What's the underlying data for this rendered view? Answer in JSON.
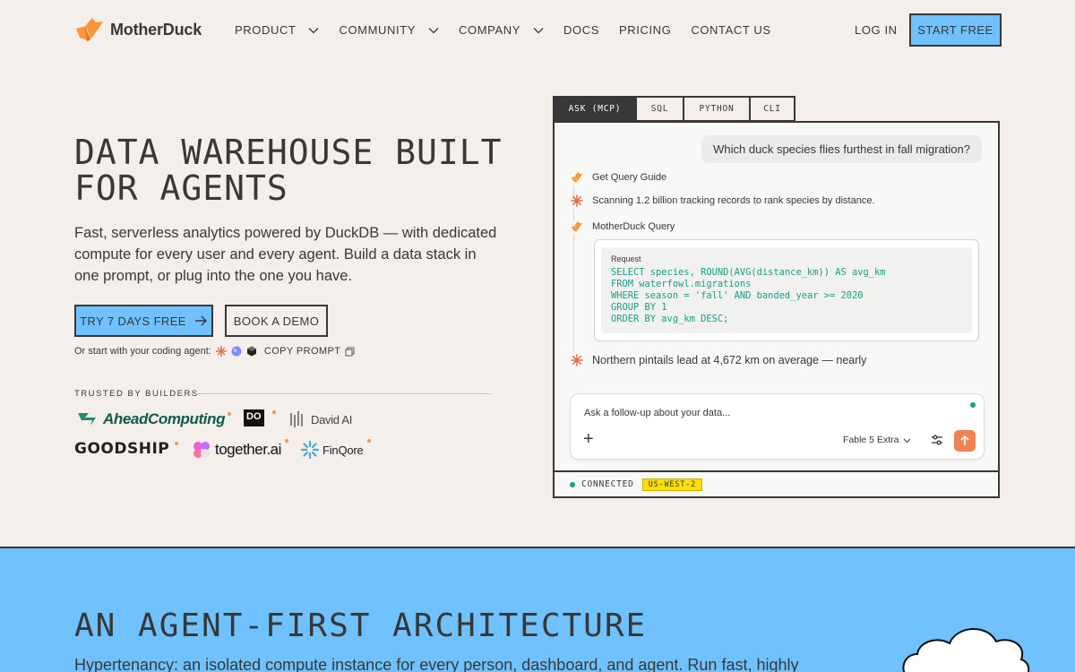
{
  "nav": {
    "brand": "MotherDuck",
    "links": [
      {
        "label": "PRODUCT",
        "dropdown": true
      },
      {
        "label": "COMMUNITY",
        "dropdown": true
      },
      {
        "label": "COMPANY",
        "dropdown": true
      },
      {
        "label": "DOCS",
        "dropdown": false
      },
      {
        "label": "PRICING",
        "dropdown": false
      },
      {
        "label": "CONTACT US",
        "dropdown": false
      }
    ],
    "login": "LOG IN",
    "start_free": "START FREE"
  },
  "hero": {
    "title_line1": "DATA WAREHOUSE BUILT",
    "title_line2": "FOR AGENTS",
    "subtitle": "Fast, serverless analytics powered by DuckDB — with dedicated compute for every user and every agent. Build a data stack in one prompt, or plug into the one you have.",
    "try_button": "TRY 7 DAYS FREE",
    "demo_button": "BOOK A DEMO",
    "coding_agent_text": "Or start with your coding agent:",
    "copy_prompt": "COPY PROMPT",
    "trusted_label": "TRUSTED BY BUILDERS",
    "logos": [
      "AheadComputing",
      "DO",
      "David AI",
      "GOODSHIP",
      "together.ai",
      "FinQore"
    ]
  },
  "terminal": {
    "tabs": [
      "ASK (MCP)",
      "SQL",
      "PYTHON",
      "CLI"
    ],
    "active_tab": "ASK (MCP)",
    "user_message": "Which duck species flies furthest in fall migration?",
    "step_guide": "Get Query Guide",
    "step_scan": "Scanning 1.2 billion tracking records to rank species by distance.",
    "step_query": "MotherDuck Query",
    "request_label": "Request",
    "sql": "SELECT species, ROUND(AVG(distance_km)) AS avg_km\nFROM waterfowl.migrations\nWHERE season = 'fall' AND banded_year >= 2020\nGROUP BY 1\nORDER BY avg_km DESC;",
    "answer": "Northern pintails lead at 4,672 km on average — nearly",
    "input_placeholder": "Ask a follow-up about your data...",
    "model": "Fable 5 Extra",
    "status": "CONNECTED",
    "region": "US-WEST-2"
  },
  "architecture": {
    "title": "AN AGENT-FIRST ARCHITECTURE",
    "subtitle": "Hypertenancy: an isolated compute instance for every person, dashboard, and agent. Run fast, highly"
  },
  "colors": {
    "accent_blue": "#6fc2ff",
    "ink": "#383838",
    "background": "#f4efea",
    "sql_green": "#16a084",
    "orange": "#ff9538",
    "region_yellow": "#ffde00"
  }
}
